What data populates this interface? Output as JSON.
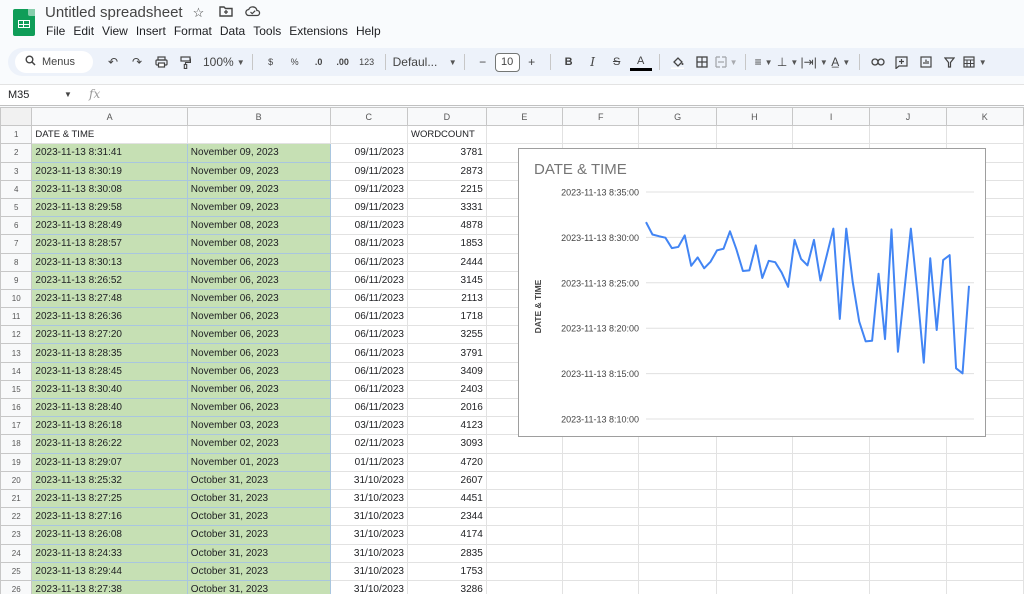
{
  "app": {
    "doc_title": "Untitled spreadsheet",
    "title_icons": [
      "star-icon",
      "move-folder-icon",
      "cloud-saved-icon"
    ],
    "menu": [
      "File",
      "Edit",
      "View",
      "Insert",
      "Format",
      "Data",
      "Tools",
      "Extensions",
      "Help"
    ]
  },
  "toolbar": {
    "search_label": "Menus",
    "zoom": "100%",
    "currency": "$",
    "percent": "%",
    "decrease_decimal": ".0",
    "increase_decimal": ".00",
    "number_format": "123",
    "font": "Defaul...",
    "font_size": "10",
    "minus": "−",
    "plus": "+",
    "bold": "B",
    "italic": "I",
    "strike": "S",
    "text_color": "A"
  },
  "formula_bar": {
    "cell_ref": "M35",
    "fx": "fx",
    "value": ""
  },
  "sheet": {
    "columns": [
      "A",
      "B",
      "C",
      "D",
      "E",
      "F",
      "G",
      "H",
      "I",
      "J",
      "K"
    ],
    "header_row": {
      "row": "1",
      "A": "DATE & TIME",
      "B": "",
      "C": "",
      "D": "WORDCOUNT"
    },
    "rows": [
      {
        "row": "2",
        "A": "2023-11-13 8:31:41",
        "B": "November 09, 2023",
        "C": "09/11/2023",
        "D": "3781"
      },
      {
        "row": "3",
        "A": "2023-11-13 8:30:19",
        "B": "November 09, 2023",
        "C": "09/11/2023",
        "D": "2873"
      },
      {
        "row": "4",
        "A": "2023-11-13 8:30:08",
        "B": "November 09, 2023",
        "C": "09/11/2023",
        "D": "2215"
      },
      {
        "row": "5",
        "A": "2023-11-13 8:29:58",
        "B": "November 09, 2023",
        "C": "09/11/2023",
        "D": "3331"
      },
      {
        "row": "6",
        "A": "2023-11-13 8:28:49",
        "B": "November 08, 2023",
        "C": "08/11/2023",
        "D": "4878"
      },
      {
        "row": "7",
        "A": "2023-11-13 8:28:57",
        "B": "November 08, 2023",
        "C": "08/11/2023",
        "D": "1853"
      },
      {
        "row": "8",
        "A": "2023-11-13 8:30:13",
        "B": "November 06, 2023",
        "C": "06/11/2023",
        "D": "2444"
      },
      {
        "row": "9",
        "A": "2023-11-13 8:26:52",
        "B": "November 06, 2023",
        "C": "06/11/2023",
        "D": "3145"
      },
      {
        "row": "10",
        "A": "2023-11-13 8:27:48",
        "B": "November 06, 2023",
        "C": "06/11/2023",
        "D": "2113"
      },
      {
        "row": "11",
        "A": "2023-11-13 8:26:36",
        "B": "November 06, 2023",
        "C": "06/11/2023",
        "D": "1718"
      },
      {
        "row": "12",
        "A": "2023-11-13 8:27:20",
        "B": "November 06, 2023",
        "C": "06/11/2023",
        "D": "3255"
      },
      {
        "row": "13",
        "A": "2023-11-13 8:28:35",
        "B": "November 06, 2023",
        "C": "06/11/2023",
        "D": "3791"
      },
      {
        "row": "14",
        "A": "2023-11-13 8:28:45",
        "B": "November 06, 2023",
        "C": "06/11/2023",
        "D": "3409"
      },
      {
        "row": "15",
        "A": "2023-11-13 8:30:40",
        "B": "November 06, 2023",
        "C": "06/11/2023",
        "D": "2403"
      },
      {
        "row": "16",
        "A": "2023-11-13 8:28:40",
        "B": "November 06, 2023",
        "C": "06/11/2023",
        "D": "2016"
      },
      {
        "row": "17",
        "A": "2023-11-13 8:26:18",
        "B": "November 03, 2023",
        "C": "03/11/2023",
        "D": "4123"
      },
      {
        "row": "18",
        "A": "2023-11-13 8:26:22",
        "B": "November 02, 2023",
        "C": "02/11/2023",
        "D": "3093"
      },
      {
        "row": "19",
        "A": "2023-11-13 8:29:07",
        "B": "November 01, 2023",
        "C": "01/11/2023",
        "D": "4720"
      },
      {
        "row": "20",
        "A": "2023-11-13 8:25:32",
        "B": "October 31, 2023",
        "C": "31/10/2023",
        "D": "2607"
      },
      {
        "row": "21",
        "A": "2023-11-13 8:27:25",
        "B": "October 31, 2023",
        "C": "31/10/2023",
        "D": "4451"
      },
      {
        "row": "22",
        "A": "2023-11-13 8:27:16",
        "B": "October 31, 2023",
        "C": "31/10/2023",
        "D": "2344"
      },
      {
        "row": "23",
        "A": "2023-11-13 8:26:08",
        "B": "October 31, 2023",
        "C": "31/10/2023",
        "D": "4174"
      },
      {
        "row": "24",
        "A": "2023-11-13 8:24:33",
        "B": "October 31, 2023",
        "C": "31/10/2023",
        "D": "2835"
      },
      {
        "row": "25",
        "A": "2023-11-13 8:29:44",
        "B": "October 31, 2023",
        "C": "31/10/2023",
        "D": "1753"
      },
      {
        "row": "26",
        "A": "2023-11-13 8:27:38",
        "B": "October 31, 2023",
        "C": "31/10/2023",
        "D": "3286"
      }
    ]
  },
  "colors": {
    "green_fill": "#c6e0b4",
    "line": "#4285f4",
    "logo": "#0f9d58"
  },
  "chart_data": {
    "type": "line",
    "title": "DATE & TIME",
    "xlabel": "",
    "ylabel": "DATE & TIME",
    "grid": true,
    "legend": "none",
    "y_ticks": [
      "2023-11-13 8:10:00",
      "2023-11-13 8:15:00",
      "2023-11-13 8:20:00",
      "2023-11-13 8:25:00",
      "2023-11-13 8:30:00",
      "2023-11-13 8:35:00"
    ],
    "y_tick_minutes": [
      490,
      495,
      500,
      505,
      510,
      515
    ],
    "ylim_minutes": [
      490,
      515
    ],
    "series": [
      {
        "name": "DATE & TIME",
        "values_minutes": [
          511.68,
          510.32,
          510.13,
          509.97,
          508.82,
          508.95,
          510.22,
          506.87,
          507.8,
          506.6,
          507.33,
          508.58,
          508.75,
          510.67,
          508.67,
          506.3,
          506.37,
          509.12,
          505.53,
          507.42,
          507.27,
          506.13,
          504.55,
          509.73,
          507.63,
          506.92,
          509.73,
          505.25,
          508.08,
          510.97,
          501.02,
          510.97,
          505.08,
          500.75,
          498.55,
          498.62,
          506.0,
          498.8,
          510.88,
          497.4,
          504.17,
          510.97,
          504.0,
          496.2,
          507.7,
          499.8,
          507.5,
          508.05,
          495.58,
          495.03,
          504.67
        ]
      }
    ]
  }
}
